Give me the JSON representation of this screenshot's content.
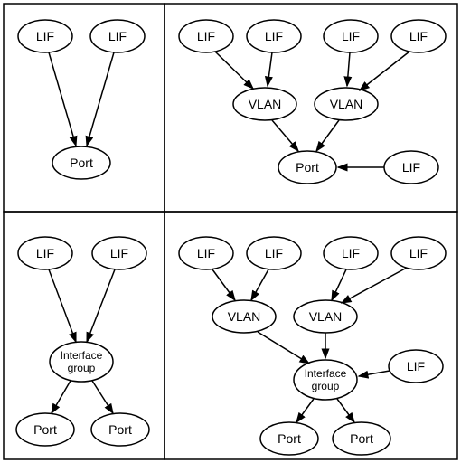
{
  "diagram": {
    "grid": {
      "rows": 2,
      "cols": 2
    },
    "labels": {
      "lif": "LIF",
      "port": "Port",
      "vlan": "VLAN",
      "ifgrp1": "Interface",
      "ifgrp2": "group"
    },
    "panels": [
      {
        "id": "top-left",
        "nodes": [
          {
            "id": "tl-lif1",
            "kind": "lif"
          },
          {
            "id": "tl-lif2",
            "kind": "lif"
          },
          {
            "id": "tl-port",
            "kind": "port"
          }
        ],
        "edges": [
          {
            "from": "tl-lif1",
            "to": "tl-port"
          },
          {
            "from": "tl-lif2",
            "to": "tl-port"
          }
        ]
      },
      {
        "id": "top-right",
        "nodes": [
          {
            "id": "tr-lif1",
            "kind": "lif"
          },
          {
            "id": "tr-lif2",
            "kind": "lif"
          },
          {
            "id": "tr-lif3",
            "kind": "lif"
          },
          {
            "id": "tr-lif4",
            "kind": "lif"
          },
          {
            "id": "tr-vlan1",
            "kind": "vlan"
          },
          {
            "id": "tr-vlan2",
            "kind": "vlan"
          },
          {
            "id": "tr-port",
            "kind": "port"
          },
          {
            "id": "tr-lif5",
            "kind": "lif"
          }
        ],
        "edges": [
          {
            "from": "tr-lif1",
            "to": "tr-vlan1"
          },
          {
            "from": "tr-lif2",
            "to": "tr-vlan1"
          },
          {
            "from": "tr-lif3",
            "to": "tr-vlan2"
          },
          {
            "from": "tr-lif4",
            "to": "tr-vlan2"
          },
          {
            "from": "tr-vlan1",
            "to": "tr-port"
          },
          {
            "from": "tr-vlan2",
            "to": "tr-port"
          },
          {
            "from": "tr-lif5",
            "to": "tr-port"
          }
        ]
      },
      {
        "id": "bottom-left",
        "nodes": [
          {
            "id": "bl-lif1",
            "kind": "lif"
          },
          {
            "id": "bl-lif2",
            "kind": "lif"
          },
          {
            "id": "bl-ifgrp",
            "kind": "ifgrp"
          },
          {
            "id": "bl-port1",
            "kind": "port"
          },
          {
            "id": "bl-port2",
            "kind": "port"
          }
        ],
        "edges": [
          {
            "from": "bl-lif1",
            "to": "bl-ifgrp"
          },
          {
            "from": "bl-lif2",
            "to": "bl-ifgrp"
          },
          {
            "from": "bl-ifgrp",
            "to": "bl-port1"
          },
          {
            "from": "bl-ifgrp",
            "to": "bl-port2"
          }
        ]
      },
      {
        "id": "bottom-right",
        "nodes": [
          {
            "id": "br-lif1",
            "kind": "lif"
          },
          {
            "id": "br-lif2",
            "kind": "lif"
          },
          {
            "id": "br-lif3",
            "kind": "lif"
          },
          {
            "id": "br-lif4",
            "kind": "lif"
          },
          {
            "id": "br-vlan1",
            "kind": "vlan"
          },
          {
            "id": "br-vlan2",
            "kind": "vlan"
          },
          {
            "id": "br-ifgrp",
            "kind": "ifgrp"
          },
          {
            "id": "br-lif5",
            "kind": "lif"
          },
          {
            "id": "br-port1",
            "kind": "port"
          },
          {
            "id": "br-port2",
            "kind": "port"
          }
        ],
        "edges": [
          {
            "from": "br-lif1",
            "to": "br-vlan1"
          },
          {
            "from": "br-lif2",
            "to": "br-vlan1"
          },
          {
            "from": "br-lif3",
            "to": "br-vlan2"
          },
          {
            "from": "br-lif4",
            "to": "br-vlan2"
          },
          {
            "from": "br-vlan1",
            "to": "br-ifgrp"
          },
          {
            "from": "br-vlan2",
            "to": "br-ifgrp"
          },
          {
            "from": "br-lif5",
            "to": "br-ifgrp"
          },
          {
            "from": "br-ifgrp",
            "to": "br-port1"
          },
          {
            "from": "br-ifgrp",
            "to": "br-port2"
          }
        ]
      }
    ]
  }
}
